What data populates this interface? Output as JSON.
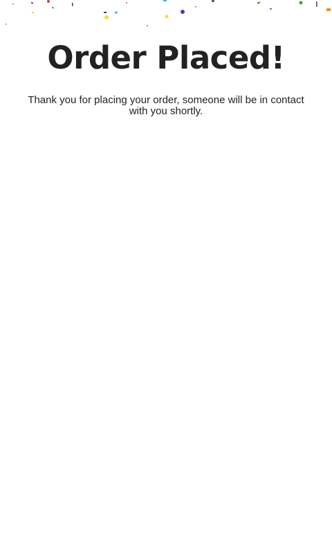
{
  "page": {
    "title": "Order Placed!",
    "message": "Thank you for placing your order, someone will be in contact with you shortly."
  },
  "colors": {
    "background": "#ffffff",
    "text": "#222222",
    "confetti": [
      "#e53935",
      "#8e24aa",
      "#1e88e5",
      "#29b6f6",
      "#fdd835",
      "#43a047",
      "#fb8c00",
      "#795548",
      "#5e35b1",
      "#f06292"
    ]
  },
  "icons": [
    "confetti-decoration"
  ]
}
